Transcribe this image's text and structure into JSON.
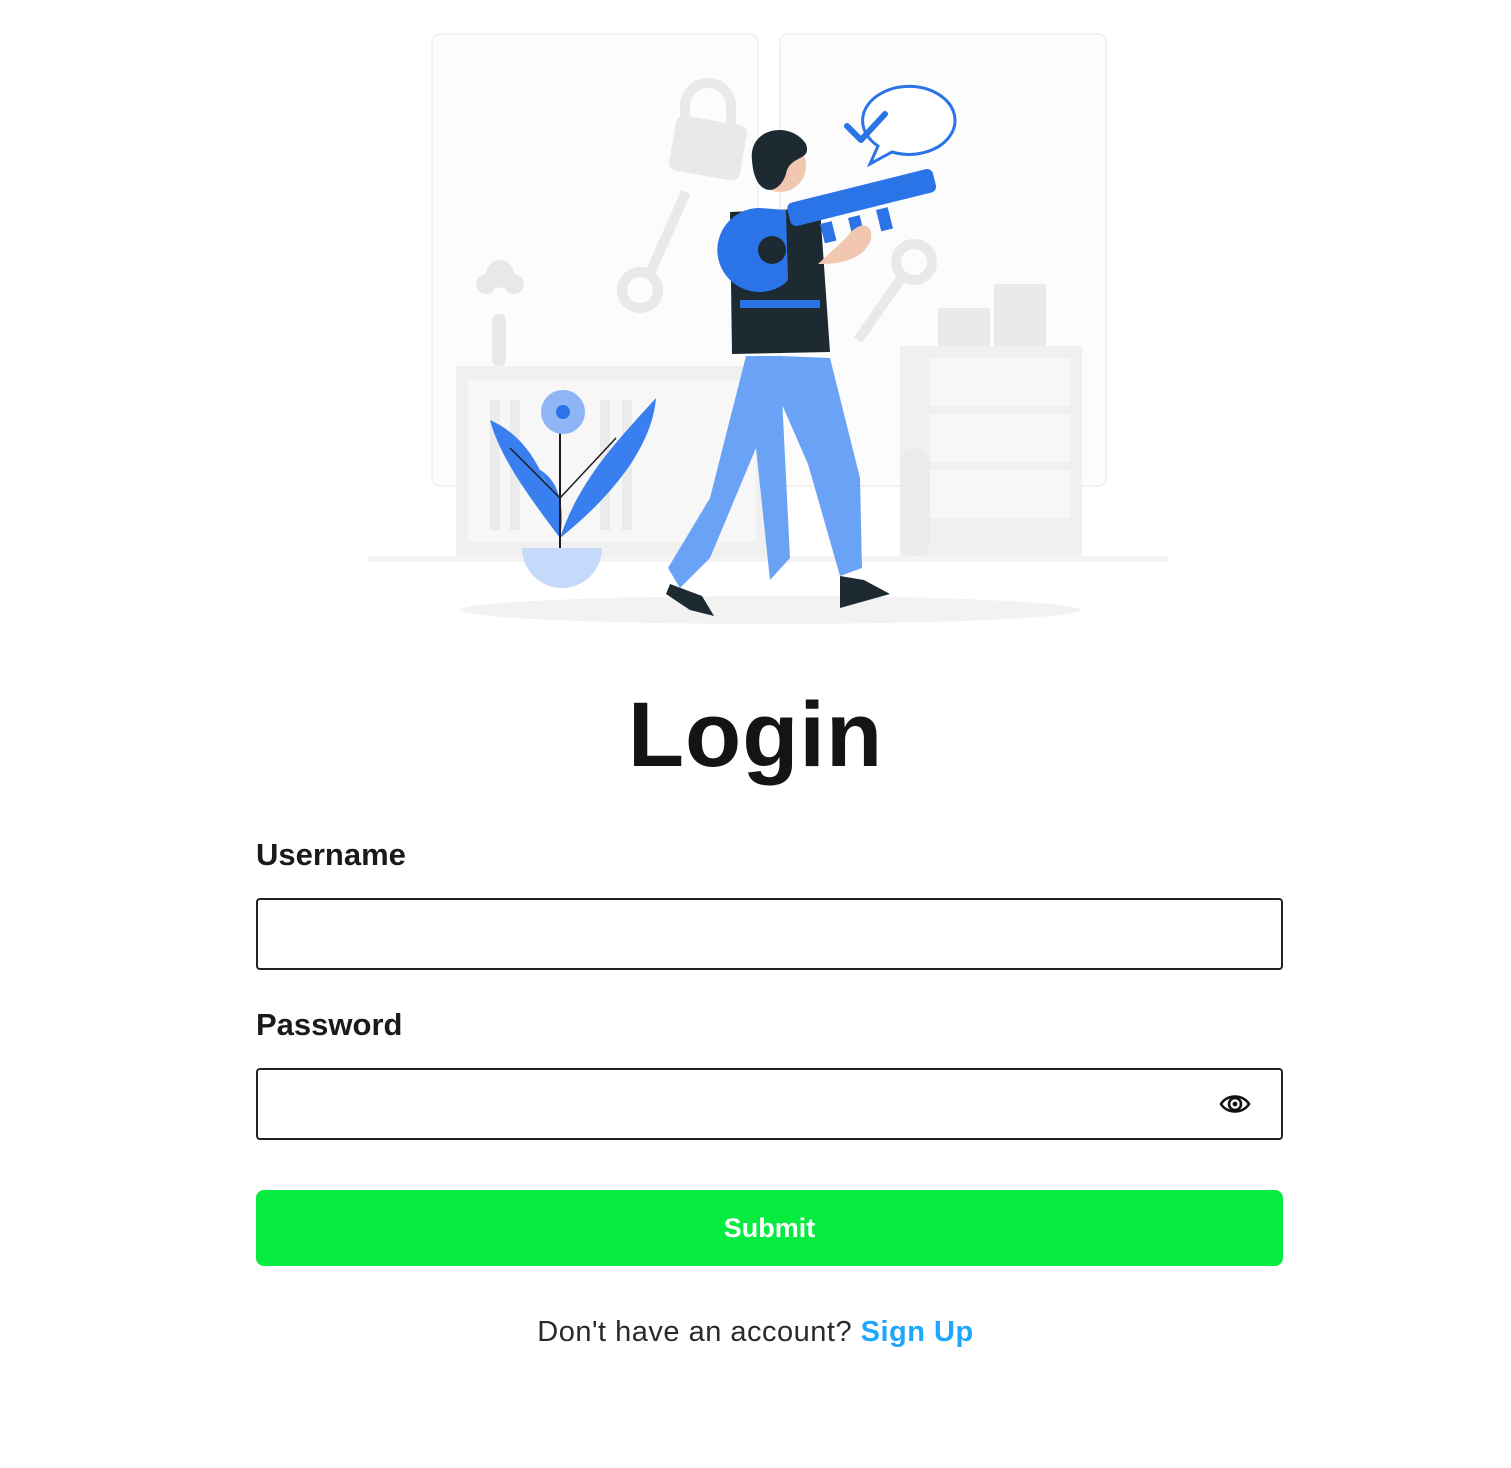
{
  "illustration": {
    "description_icon": "woman-holding-key-illustration",
    "accent_color": "#2b74e8",
    "light_accent": "#6aa3f5"
  },
  "page": {
    "title": "Login"
  },
  "form": {
    "username_label": "Username",
    "username_value": "",
    "password_label": "Password",
    "password_value": "",
    "password_toggle_icon": "eye-icon",
    "submit_label": "Submit",
    "submit_color": "#05eb3f"
  },
  "footer": {
    "prompt": "Don't have an account?",
    "signup_label": "Sign Up",
    "link_color": "#1ea7ff"
  }
}
